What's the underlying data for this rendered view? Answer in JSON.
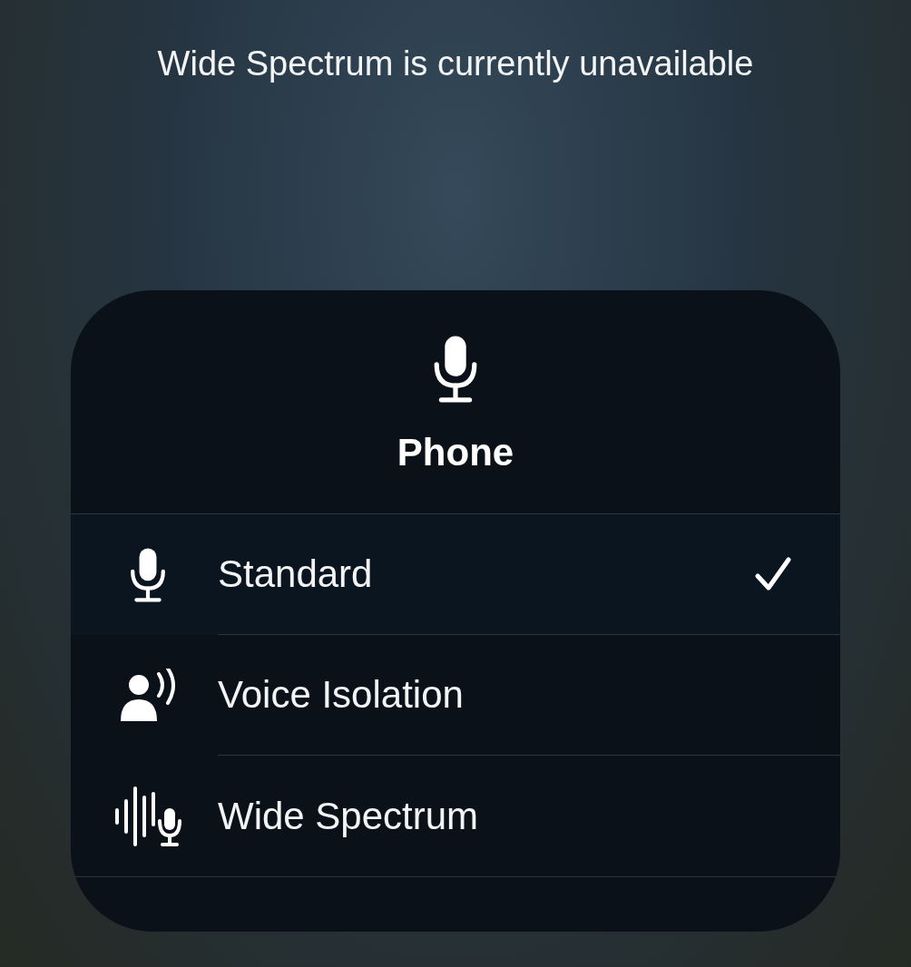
{
  "notice": "Wide Spectrum is currently unavailable",
  "panel": {
    "title": "Phone",
    "modes": [
      {
        "kind": "mic",
        "label": "Standard",
        "selected": true
      },
      {
        "kind": "voice",
        "label": "Voice Isolation",
        "selected": false
      },
      {
        "kind": "wide",
        "label": "Wide Spectrum",
        "selected": false
      }
    ]
  }
}
